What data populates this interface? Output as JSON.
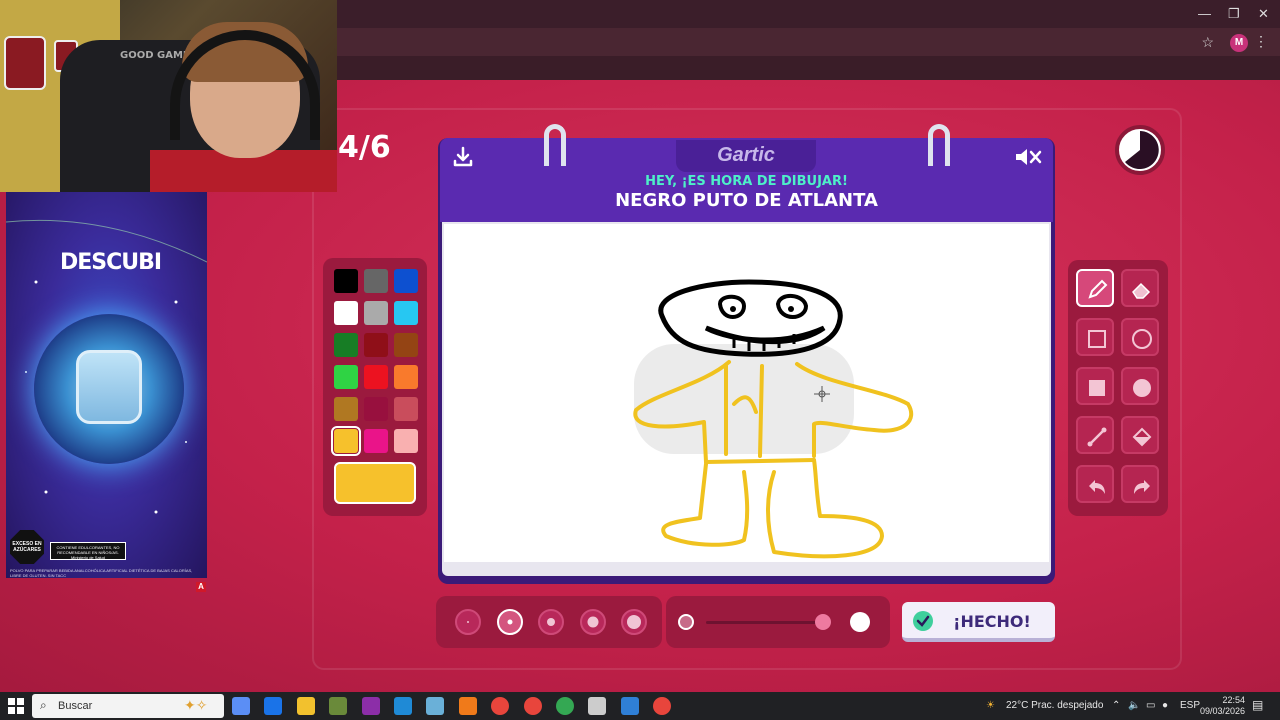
{
  "window_controls": {
    "minimize": "—",
    "restore": "❐",
    "close": "✕"
  },
  "browser": {
    "profile_initial": "M",
    "bookmark_icon": "star-icon",
    "menu_icon": "kebab-icon"
  },
  "webcam": {
    "chair_label": "GOOD GAME"
  },
  "ad": {
    "headline": "DESCUBI",
    "seal_text": "EXCESO EN AZÚCARES",
    "warning": "CONTIENE EDULCORANTES, NO RECOMENDABLE EN NIÑOS/AS. Ministerio de Salud",
    "footnote": "POLVO PARA PREPARAR BEBIDA ANALCOHÓLICA ARTIFICIAL DIETÉTICA DE BAJAS CALORÍAS, LIBRE DE GLUTEN. SIN TACC",
    "ad_badge": "A"
  },
  "game": {
    "round": "4/6",
    "logo": "Gartic",
    "subtitle": "HEY, ¡ES HORA DE DIBUJAR!",
    "word": "NEGRO PUTO DE ATLANTA",
    "done_label": "¡HECHO!",
    "selected_color": "#f6c12c",
    "opacity_fraction": 0.96
  },
  "palette": [
    "#000000",
    "#666666",
    "#0d50d0",
    "#ffffff",
    "#aaaaaa",
    "#27c7f2",
    "#177d25",
    "#8f0f18",
    "#944414",
    "#2fd344",
    "#ec1220",
    "#f97a2c",
    "#b07822",
    "#98103e",
    "#c94d5c",
    "#f6c12c",
    "#ea1489",
    "#f9b0b0"
  ],
  "tools": [
    {
      "name": "pencil-tool",
      "icon": "pencil-icon",
      "active": true
    },
    {
      "name": "eraser-tool",
      "icon": "eraser-icon",
      "active": false
    },
    {
      "name": "rectangle-outline-tool",
      "icon": "square-outline-icon",
      "active": false
    },
    {
      "name": "ellipse-outline-tool",
      "icon": "circle-outline-icon",
      "active": false
    },
    {
      "name": "rectangle-fill-tool",
      "icon": "square-fill-icon",
      "active": false
    },
    {
      "name": "ellipse-fill-tool",
      "icon": "circle-fill-icon",
      "active": false
    },
    {
      "name": "line-tool",
      "icon": "line-icon",
      "active": false
    },
    {
      "name": "fill-bucket-tool",
      "icon": "bucket-icon",
      "active": false
    },
    {
      "name": "undo-tool",
      "icon": "undo-icon",
      "active": false
    },
    {
      "name": "redo-tool",
      "icon": "redo-icon",
      "active": false
    }
  ],
  "brush_sizes": [
    {
      "name": "size-1",
      "active": false
    },
    {
      "name": "size-2",
      "active": true
    },
    {
      "name": "size-3",
      "active": false
    },
    {
      "name": "size-4",
      "active": false
    },
    {
      "name": "size-5",
      "active": false
    }
  ],
  "taskbar": {
    "search_placeholder": "Buscar",
    "weather": "22°C  Prac. despejado",
    "language": "ESP",
    "time": "22:54",
    "date": "09/03/2026",
    "apps": [
      "copilot-icon",
      "outlook-icon",
      "file-explorer-icon",
      "minecraft-icon",
      "winrar-icon",
      "edge-icon",
      "notes-icon",
      "vlc-icon",
      "chrome-icon",
      "chrome-profile-icon",
      "chrome-profile-2-icon",
      "github-icon",
      "photos-icon",
      "chrome-active-icon"
    ]
  }
}
